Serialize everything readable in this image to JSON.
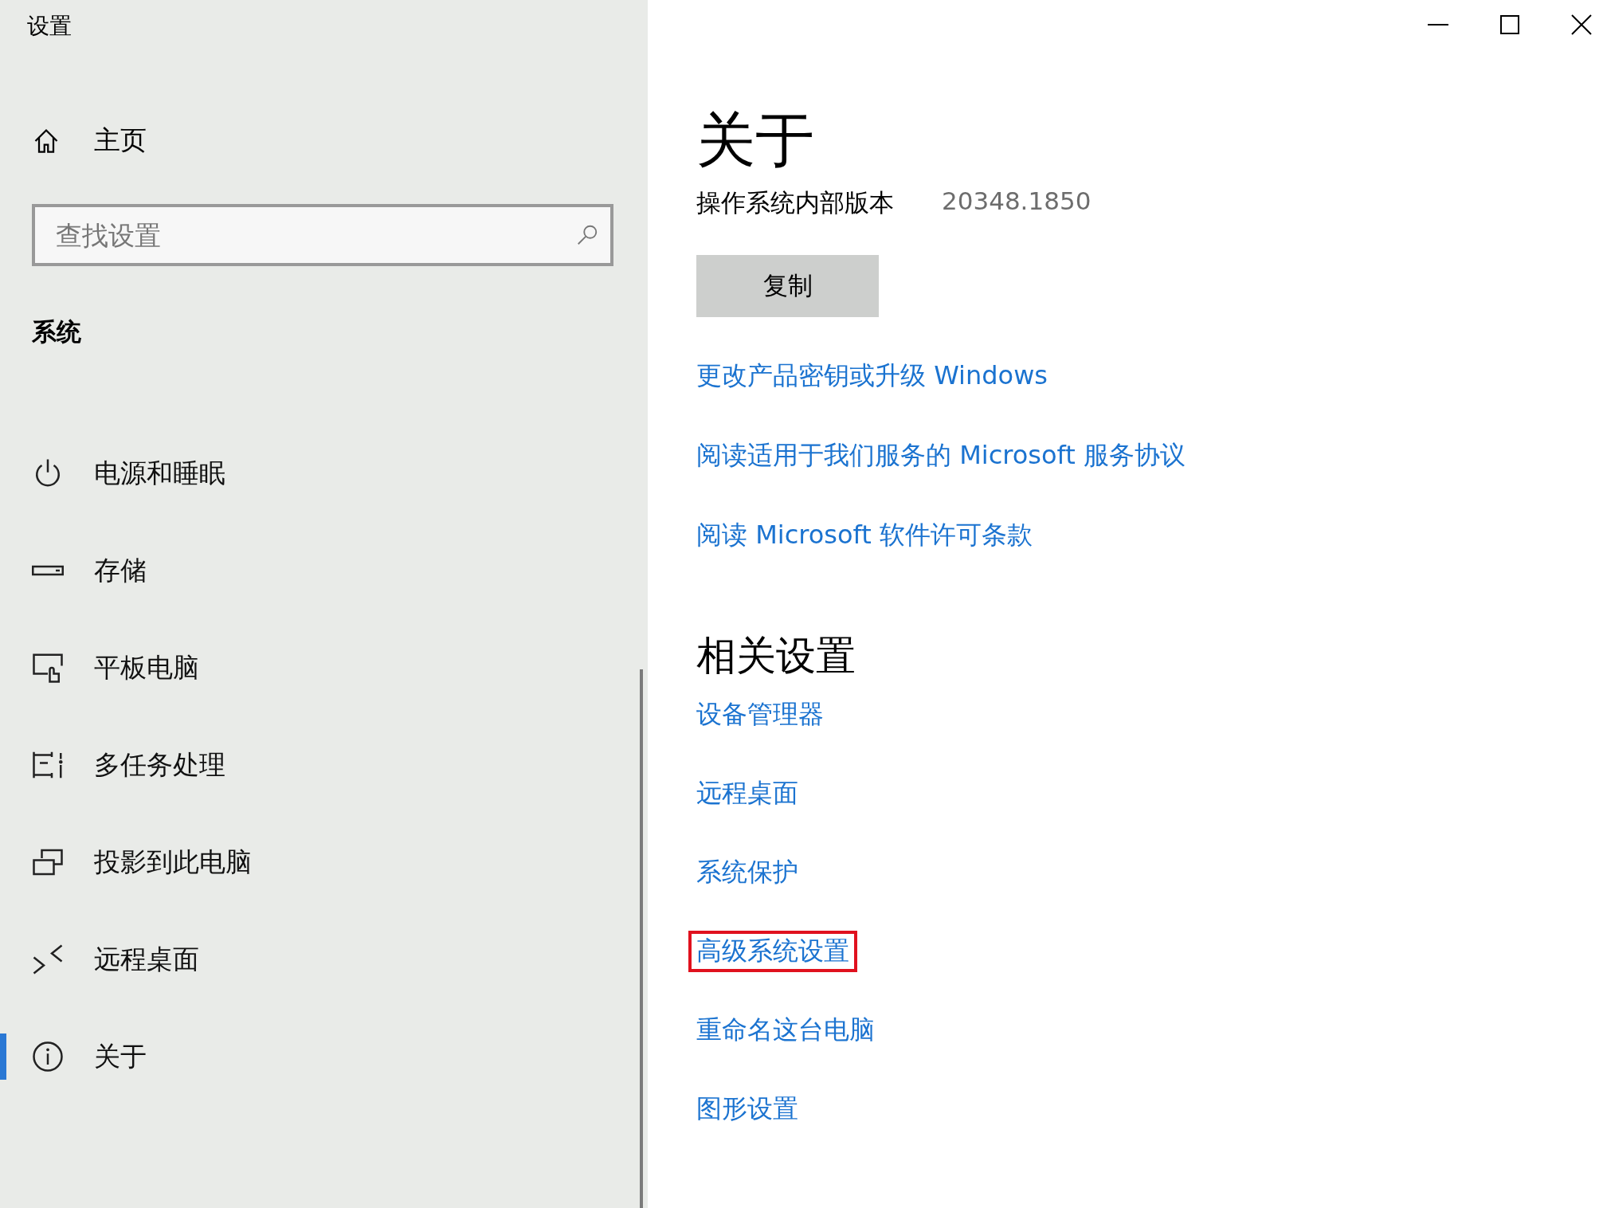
{
  "window": {
    "title": "设置"
  },
  "sidebar": {
    "home": {
      "label": "主页"
    },
    "search": {
      "placeholder": "查找设置"
    },
    "section": "系统",
    "items": [
      {
        "kind": "power",
        "label": "电源和睡眠",
        "selected": false
      },
      {
        "kind": "storage",
        "label": "存储",
        "selected": false
      },
      {
        "kind": "tablet",
        "label": "平板电脑",
        "selected": false
      },
      {
        "kind": "multitask",
        "label": "多任务处理",
        "selected": false
      },
      {
        "kind": "project",
        "label": "投影到此电脑",
        "selected": false
      },
      {
        "kind": "remote",
        "label": "远程桌面",
        "selected": false
      },
      {
        "kind": "about",
        "label": "关于",
        "selected": true
      }
    ]
  },
  "content": {
    "title": "关于",
    "build": {
      "label": "操作系统内部版本",
      "value": "20348.1850"
    },
    "copy_button": "复制",
    "links": [
      "更改产品密钥或升级 Windows",
      "阅读适用于我们服务的 Microsoft 服务协议",
      "阅读 Microsoft 软件许可条款"
    ],
    "related": {
      "heading": "相关设置",
      "links": [
        {
          "label": "设备管理器",
          "highlighted": false
        },
        {
          "label": "远程桌面",
          "highlighted": false
        },
        {
          "label": "系统保护",
          "highlighted": false
        },
        {
          "label": "高级系统设置",
          "highlighted": true
        },
        {
          "label": "重命名这台电脑",
          "highlighted": false
        },
        {
          "label": "图形设置",
          "highlighted": false
        }
      ]
    }
  }
}
